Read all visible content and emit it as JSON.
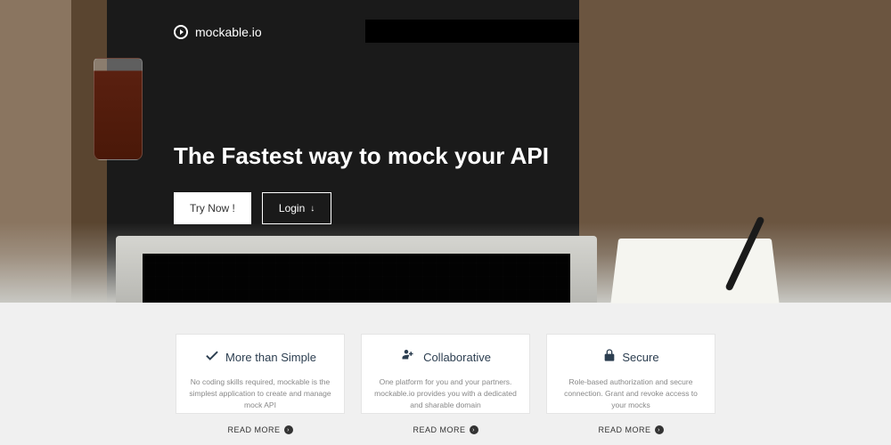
{
  "brand": "mockable.io",
  "hero": {
    "title": "The Fastest way to mock your API",
    "try_label": "Try Now !",
    "login_label": "Login"
  },
  "features": [
    {
      "icon": "check",
      "title": "More than Simple",
      "description": "No coding skills required, mockable is the simplest application to create and manage mock API",
      "cta": "READ MORE"
    },
    {
      "icon": "users-plus",
      "title": "Collaborative",
      "description": "One platform for you and your partners. mockable.io provides you with a dedicated and sharable domain",
      "cta": "READ MORE"
    },
    {
      "icon": "lock",
      "title": "Secure",
      "description": "Role-based authorization and secure connection. Grant and revoke access to your mocks",
      "cta": "READ MORE"
    }
  ]
}
